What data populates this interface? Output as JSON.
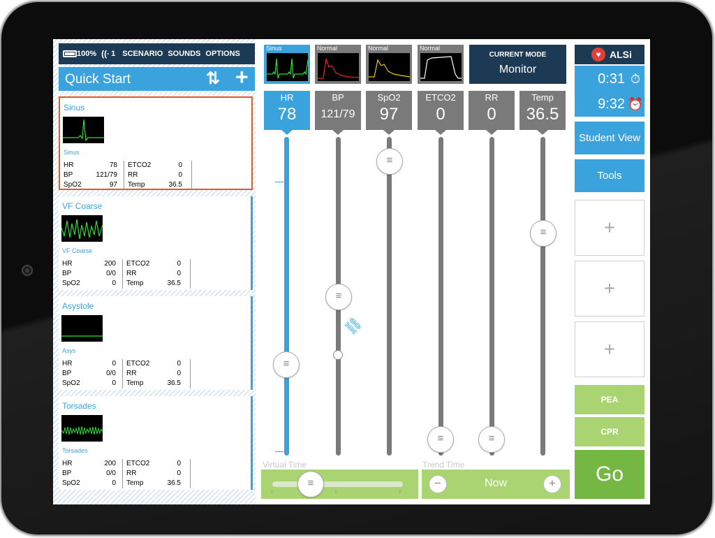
{
  "statusbar": {
    "battery": "100%",
    "wifi_count": "1",
    "menu": [
      "SCENARIO",
      "SOUNDS",
      "OPTIONS"
    ]
  },
  "quickstart": {
    "title": "Quick Start"
  },
  "scenarios": [
    {
      "name": "Sinus",
      "rhythm": "Sinus",
      "selected": true,
      "vitals": [
        [
          "HR",
          "78",
          "ETCO2",
          "0"
        ],
        [
          "BP",
          "121/79",
          "RR",
          "0"
        ],
        [
          "SpO2",
          "97",
          "Temp",
          "36.5"
        ]
      ]
    },
    {
      "name": "VF Coarse",
      "rhythm": "VF Coarse",
      "selected": false,
      "vitals": [
        [
          "HR",
          "200",
          "ETCO2",
          "0"
        ],
        [
          "BP",
          "0/0",
          "RR",
          "0"
        ],
        [
          "SpO2",
          "0",
          "Temp",
          "36.5"
        ]
      ]
    },
    {
      "name": "Asystole",
      "rhythm": "Asys",
      "selected": false,
      "vitals": [
        [
          "HR",
          "0",
          "ETCO2",
          "0"
        ],
        [
          "BP",
          "0/0",
          "RR",
          "0"
        ],
        [
          "SpO2",
          "0",
          "Temp",
          "36.5"
        ]
      ]
    },
    {
      "name": "Torsades",
      "rhythm": "Torsades",
      "selected": false,
      "vitals": [
        [
          "HR",
          "200",
          "ETCO2",
          "0"
        ],
        [
          "BP",
          "0/0",
          "RR",
          "0"
        ],
        [
          "SpO2",
          "0",
          "Temp",
          "36.5"
        ]
      ]
    }
  ],
  "monitors": [
    {
      "key": "hr",
      "scope_label": "Sinus",
      "name": "HR",
      "value": "78",
      "active": true
    },
    {
      "key": "bp",
      "scope_label": "Normal",
      "name": "BP",
      "value": "121/79",
      "active": false
    },
    {
      "key": "spo2",
      "scope_label": "Normal",
      "name": "SpO2",
      "value": "97",
      "active": false
    },
    {
      "key": "etco2",
      "scope_label": "Normal",
      "name": "ETCO2",
      "value": "0",
      "active": false
    },
    {
      "key": "rr",
      "scope_label": "",
      "name": "RR",
      "value": "0",
      "active": false
    },
    {
      "key": "temp",
      "scope_label": "",
      "name": "Temp",
      "value": "36.5",
      "active": false
    }
  ],
  "mode": {
    "label": "CURRENT MODE",
    "value": "Monitor"
  },
  "virtual_time": {
    "label": "Virtual Time",
    "ticks": [
      "0",
      "1",
      "2"
    ]
  },
  "trend_time": {
    "label": "Trend Time",
    "value": "Now",
    "minus": "−",
    "plus": "+"
  },
  "brand": {
    "name": "ALSi"
  },
  "timers": {
    "elapsed": "0:31",
    "clock": "9:32"
  },
  "buttons": {
    "student_view": "Student View",
    "tools": "Tools",
    "add_slot": "+",
    "pea": "PEA",
    "cpr": "CPR",
    "go": "Go"
  },
  "colors": {
    "accent": "#3aa3dd",
    "navy": "#1d3a55",
    "green": "#a9d471",
    "go_green": "#75b743",
    "selection": "#e1592b",
    "waveform": "#2ee02e"
  }
}
